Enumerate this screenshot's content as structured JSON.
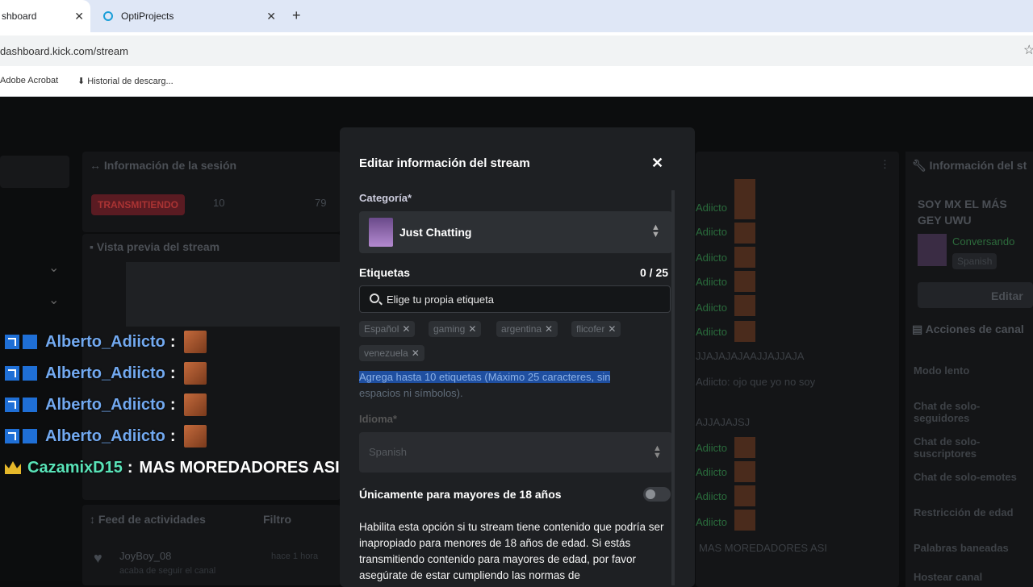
{
  "browser": {
    "tabs": [
      {
        "label": "shboard",
        "close": "✕"
      },
      {
        "label": "OptiProjects",
        "close": "✕"
      }
    ],
    "new_tab": "+",
    "url": "dashboard.kick.com/stream",
    "bookmarks": [
      "Adobe Acrobat",
      "Historial de descarg..."
    ]
  },
  "dashboard": {
    "session_title": "Información de la sesión",
    "live_badge": "TRANSMITIENDO",
    "stat_1": "10",
    "stat_2": "79",
    "preview_title": "Vista previa del stream",
    "feed_title": "Feed de actividades",
    "feed_filter": "Filtro",
    "feed_user": "JoyBoy_08",
    "feed_sub": "acaba de seguir el canal",
    "feed_time": "hace 1 hora",
    "chat_bg": {
      "user": "Adiicto",
      "line_1": "JJAJAJAJAAJJAJJAJA",
      "line_2": "Adiicto: ojo que yo no soy",
      "line_3": "AJJAJAJSJ",
      "line_4": "MAS MOREDADORES ASI"
    },
    "right_panel": {
      "title": "Información del st",
      "stream_title": "SOY MX EL MÁS GEY UWU",
      "status": "Conversando",
      "tag": "Spanish",
      "edit": "Editar",
      "actions_title": "Acciones de canal",
      "actions": [
        "Modo lento",
        "Chat de solo-seguidores",
        "Chat de solo-suscriptores",
        "Chat de solo-emotes",
        "Restricción de edad",
        "Palabras baneadas",
        "Hostear canal"
      ]
    }
  },
  "overlay_chat": [
    {
      "user": "Alberto_Adiicto",
      "colon": ":",
      "message": ""
    },
    {
      "user": "Alberto_Adiicto",
      "colon": ":",
      "message": ""
    },
    {
      "user": "Alberto_Adiicto",
      "colon": ":",
      "message": ""
    },
    {
      "user": "Alberto_Adiicto",
      "colon": ":",
      "message": ""
    },
    {
      "user": "CazamixD15",
      "colon": ":",
      "message": "MAS MOREDADORES ASI"
    }
  ],
  "modal": {
    "title": "Editar información del stream",
    "close": "✕",
    "category_label": "Categoría*",
    "category_value": "Just Chatting",
    "tags_label": "Etiquetas",
    "tags_count": "0 / 25",
    "tags_placeholder": "Elige tu propia etiqueta",
    "tag_chips": [
      "Español",
      "gaming",
      "argentina",
      "flicofer",
      "venezuela"
    ],
    "tags_help_highlight": "Agrega hasta 10 etiquetas (Máximo 25 caracteres, sin",
    "tags_help_rest": "espacios ni símbolos).",
    "language_label": "Idioma*",
    "language_value": "Spanish",
    "adult_label": "Únicamente para mayores de 18 años",
    "adult_enabled": false,
    "adult_help": "Habilita esta opción si tu stream tiene contenido que podría ser inapropiado para menores de 18 años de edad. Si estás transmitiendo contenido para mayores de edad, por favor asegúrate de estar cumpliendo las normas de"
  },
  "colors": {
    "modal_bg": "#1e2023",
    "accent_blue": "#72a9f0",
    "accent_green": "#59e3b8",
    "live_red": "#5a1b22"
  }
}
